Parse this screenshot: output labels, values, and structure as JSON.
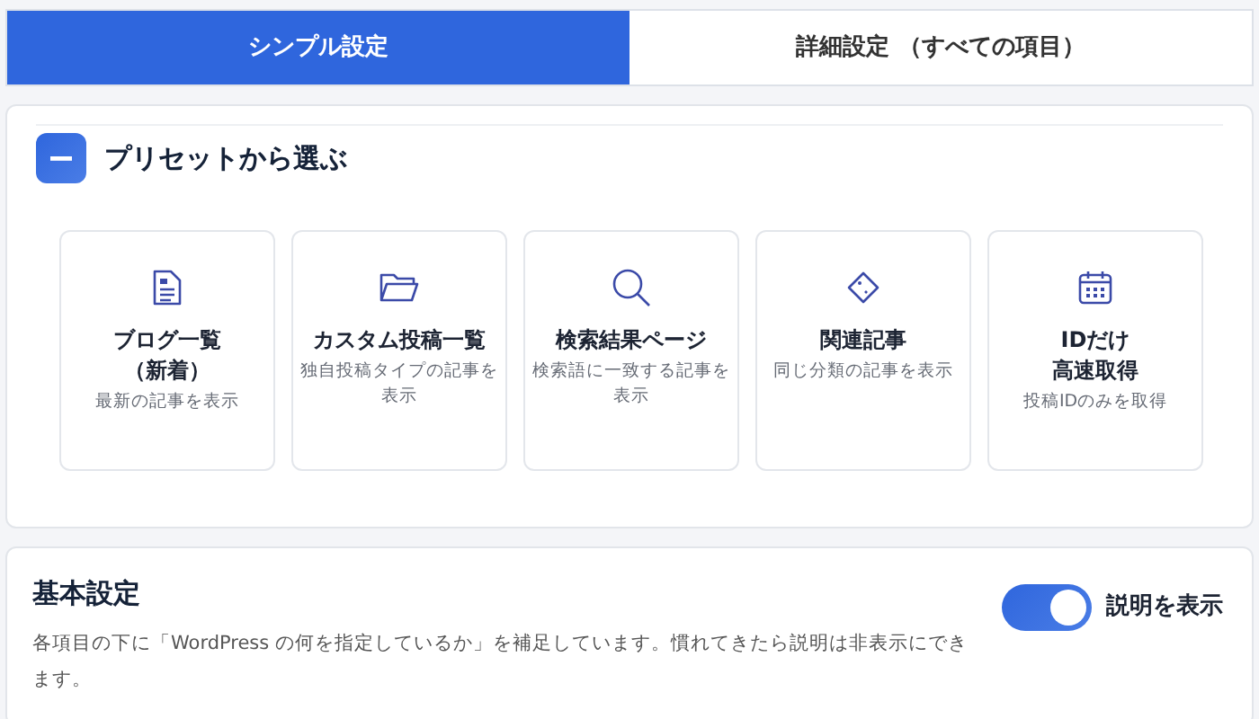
{
  "tabs": [
    {
      "label": "シンプル設定",
      "selected": true
    },
    {
      "label": "詳細設定 （すべての項目）",
      "selected": false
    }
  ],
  "preset_panel": {
    "title": "プリセットから選ぶ",
    "expanded": true,
    "presets": [
      {
        "title_lines": [
          "ブログ一覧",
          "（新着）"
        ],
        "description": "最新の記事を表示"
      },
      {
        "title_lines": [
          "カスタム投稿一覧"
        ],
        "description": "独自投稿タイプの記事を表示"
      },
      {
        "title_lines": [
          "検索結果ページ"
        ],
        "description": "検索語に一致する記事を表示"
      },
      {
        "title_lines": [
          "関連記事"
        ],
        "description": "同じ分類の記事を表示"
      },
      {
        "title_lines": [
          "IDだけ",
          "高速取得"
        ],
        "description": "投稿IDのみを取得"
      }
    ]
  },
  "basic_settings": {
    "title": "基本設定",
    "description": "各項目の下に「WordPress の何を指定しているか」を補足しています。慣れてきたら説明は非表示にできます。",
    "toggle": {
      "label": "説明を表示",
      "on": true
    }
  }
}
